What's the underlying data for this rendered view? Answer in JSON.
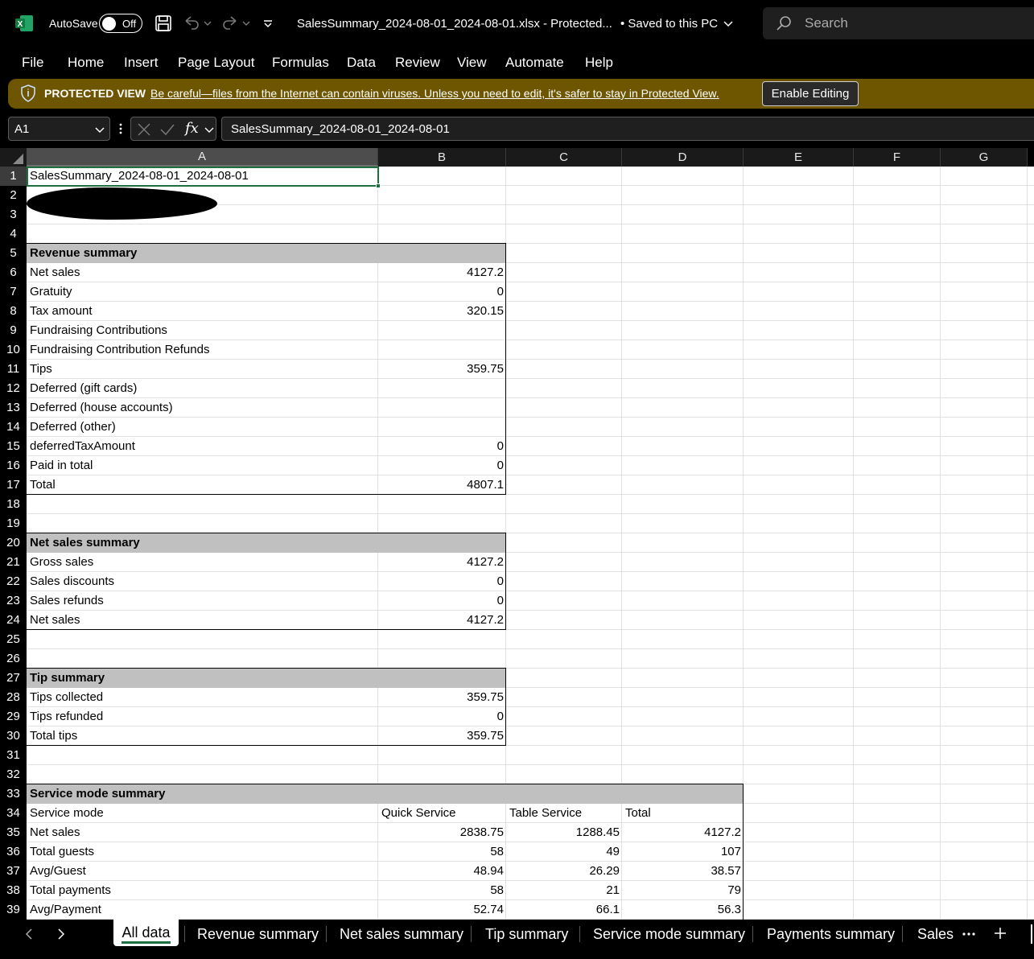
{
  "titlebar": {
    "autosave_label": "AutoSave",
    "autosave_state": "Off",
    "filename": "SalesSummary_2024-08-01_2024-08-01.xlsx  -  Protected...",
    "save_status": "• Saved to this PC",
    "search_placeholder": "Search",
    "icons": [
      "excel-logo-icon",
      "save-icon",
      "undo-icon",
      "redo-icon",
      "customize-toolbar-icon",
      "search-icon"
    ]
  },
  "menu": [
    "File",
    "Home",
    "Insert",
    "Page Layout",
    "Formulas",
    "Data",
    "Review",
    "View",
    "Automate",
    "Help"
  ],
  "protected_view": {
    "title": "PROTECTED VIEW",
    "message": "Be careful—files from the Internet can contain viruses. Unless you need to edit, it's safer to stay in Protected View.",
    "button": "Enable Editing"
  },
  "formula_bar": {
    "name_box": "A1",
    "fx": "fx",
    "content": "SalesSummary_2024-08-01_2024-08-01"
  },
  "columns": [
    "A",
    "B",
    "C",
    "D",
    "E",
    "F",
    "G"
  ],
  "rows": [
    "1",
    "2",
    "3",
    "4",
    "5",
    "6",
    "7",
    "8",
    "9",
    "10",
    "11",
    "12",
    "13",
    "14",
    "15",
    "16",
    "17",
    "18",
    "19",
    "20",
    "21",
    "22",
    "23",
    "24",
    "25",
    "26",
    "27",
    "28",
    "29",
    "30",
    "31",
    "32",
    "33",
    "34",
    "35",
    "36",
    "37",
    "38",
    "39"
  ],
  "cells": {
    "r1": "SalesSummary_2024-08-01_2024-08-01",
    "revenue": {
      "header": "Revenue summary",
      "items": [
        {
          "label": "Net sales",
          "value": "4127.2"
        },
        {
          "label": "Gratuity",
          "value": "0"
        },
        {
          "label": "Tax amount",
          "value": "320.15"
        },
        {
          "label": "Fundraising Contributions",
          "value": ""
        },
        {
          "label": "Fundraising Contribution Refunds",
          "value": ""
        },
        {
          "label": "Tips",
          "value": "359.75"
        },
        {
          "label": "Deferred (gift cards)",
          "value": ""
        },
        {
          "label": "Deferred (house accounts)",
          "value": ""
        },
        {
          "label": "Deferred (other)",
          "value": ""
        },
        {
          "label": "deferredTaxAmount",
          "value": "0"
        },
        {
          "label": "Paid in total",
          "value": "0"
        },
        {
          "label": "Total",
          "value": "4807.1"
        }
      ]
    },
    "net_sales": {
      "header": "Net sales summary",
      "items": [
        {
          "label": "Gross sales",
          "value": "4127.2"
        },
        {
          "label": "Sales discounts",
          "value": "0"
        },
        {
          "label": "Sales refunds",
          "value": "0"
        },
        {
          "label": "Net sales",
          "value": "4127.2"
        }
      ]
    },
    "tips": {
      "header": "Tip summary",
      "items": [
        {
          "label": "Tips collected",
          "value": "359.75"
        },
        {
          "label": "Tips refunded",
          "value": "0"
        },
        {
          "label": "Total tips",
          "value": "359.75"
        }
      ]
    },
    "service_mode": {
      "header": "Service mode summary",
      "col_headers": [
        "Service mode",
        "Quick Service",
        "Table Service",
        "Total"
      ],
      "items": [
        {
          "label": "Net sales",
          "values": [
            "2838.75",
            "1288.45",
            "4127.2"
          ]
        },
        {
          "label": "Total guests",
          "values": [
            "58",
            "49",
            "107"
          ]
        },
        {
          "label": "Avg/Guest",
          "values": [
            "48.94",
            "26.29",
            "38.57"
          ]
        },
        {
          "label": "Total payments",
          "values": [
            "58",
            "21",
            "79"
          ]
        },
        {
          "label": "Avg/Payment",
          "values": [
            "52.74",
            "66.1",
            "56.3"
          ]
        }
      ]
    }
  },
  "sheet_tabs": [
    "All data",
    "Revenue summary",
    "Net sales summary",
    "Tip summary",
    "Service mode summary",
    "Payments summary",
    "Sales"
  ],
  "colors": {
    "accent": "#1e6e3f",
    "warning_bar": "#6e5600",
    "header_fill": "#c0c0c0"
  }
}
